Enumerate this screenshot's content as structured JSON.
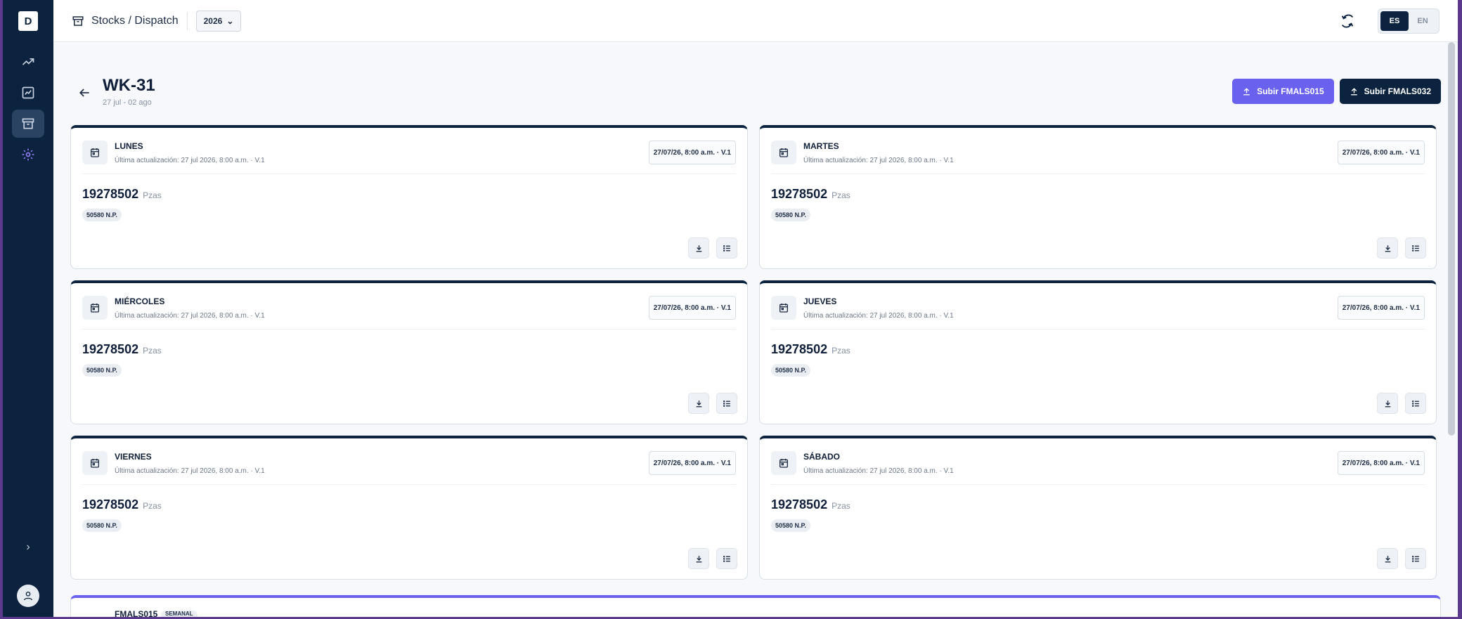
{
  "sidebar": {
    "logo": "D",
    "items": [
      {
        "icon": "trend-chart-icon",
        "active": false
      },
      {
        "icon": "report-icon",
        "active": false
      },
      {
        "icon": "archive-box-icon",
        "active": true
      },
      {
        "icon": "settings-gear-icon",
        "active": false
      }
    ]
  },
  "header": {
    "breadcrumb": "Stocks / Dispatch",
    "year": "2026",
    "lang_es": "ES",
    "lang_en": "EN",
    "active_lang": "ES"
  },
  "page": {
    "title": "WK-31",
    "subtitle": "27 jul - 02 ago",
    "upload_fmals015": "Subir FMALS015",
    "upload_fmals032": "Subir FMALS032"
  },
  "days": [
    {
      "name": "LUNES",
      "update": "Última actualización: 27 jul 2026, 8:00 a.m. · V.1",
      "stamp": "27/07/26, 8:00 a.m. · V.1",
      "qty": "19278502",
      "unit": "Pzas",
      "np": "50580 N.P."
    },
    {
      "name": "MARTES",
      "update": "Última actualización: 27 jul 2026, 8:00 a.m. · V.1",
      "stamp": "27/07/26, 8:00 a.m. · V.1",
      "qty": "19278502",
      "unit": "Pzas",
      "np": "50580 N.P."
    },
    {
      "name": "MIÉRCOLES",
      "update": "Última actualización: 27 jul 2026, 8:00 a.m. · V.1",
      "stamp": "27/07/26, 8:00 a.m. · V.1",
      "qty": "19278502",
      "unit": "Pzas",
      "np": "50580 N.P."
    },
    {
      "name": "JUEVES",
      "update": "Última actualización: 27 jul 2026, 8:00 a.m. · V.1",
      "stamp": "27/07/26, 8:00 a.m. · V.1",
      "qty": "19278502",
      "unit": "Pzas",
      "np": "50580 N.P."
    },
    {
      "name": "VIERNES",
      "update": "Última actualización: 27 jul 2026, 8:00 a.m. · V.1",
      "stamp": "27/07/26, 8:00 a.m. · V.1",
      "qty": "19278502",
      "unit": "Pzas",
      "np": "50580 N.P."
    },
    {
      "name": "SÁBADO",
      "update": "Última actualización: 27 jul 2026, 8:00 a.m. · V.1",
      "stamp": "27/07/26, 8:00 a.m. · V.1",
      "qty": "19278502",
      "unit": "Pzas",
      "np": "50580 N.P."
    }
  ],
  "weekly": {
    "title": "FMALS015",
    "tag": "SEMANAL"
  },
  "colors": {
    "navy": "#0c2340",
    "purple": "#6a62ee",
    "background": "#f6f8fb"
  }
}
